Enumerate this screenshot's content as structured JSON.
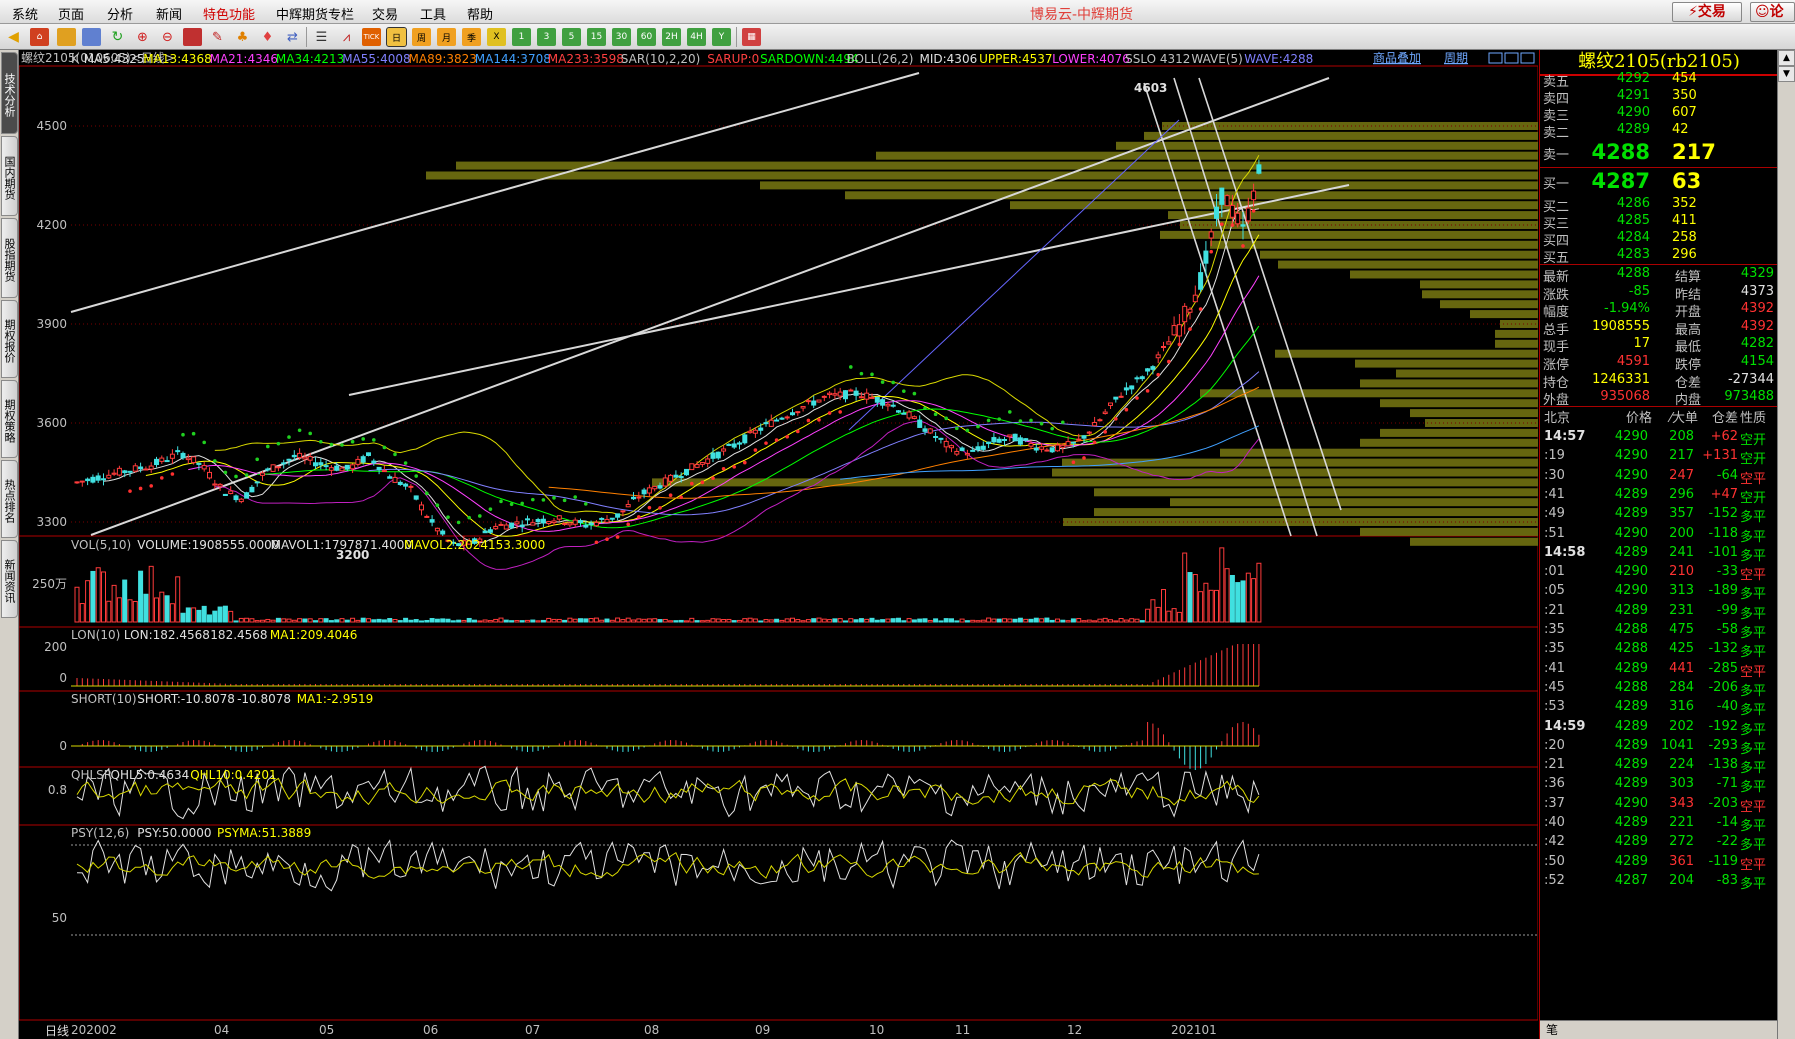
{
  "menu": {
    "items": [
      "系统",
      "页面",
      "分析",
      "新闻",
      "特色功能",
      "中辉期货专栏",
      "交易",
      "工具",
      "帮助"
    ],
    "highlight_index": 4,
    "app_title": "博易云-中辉期货",
    "trade_button": "交易",
    "comment_button": "论"
  },
  "left_tabs": [
    "技术分析",
    "国内期货",
    "股指期货",
    "期权报价",
    "期权策略",
    "热点排名",
    "新闻资讯"
  ],
  "chart": {
    "header_left": "螺纹2105(010605)<日线>",
    "header_link1": "商品叠加",
    "header_link2": "周期",
    "bottom_label": "日线",
    "main_indicators": [
      {
        "text": "K",
        "color": "#c0c0c0"
      },
      {
        "text": "MA5:4325",
        "color": "#e0e0e0"
      },
      {
        "text": "MA13:4368",
        "color": "#ffff00"
      },
      {
        "text": "MA21:4346",
        "color": "#ff40ff"
      },
      {
        "text": "MA34:4213",
        "color": "#00ff00"
      },
      {
        "text": "MA55:4008",
        "color": "#8080ff"
      },
      {
        "text": "MA89:3823",
        "color": "#ff8000"
      },
      {
        "text": "MA144:3708",
        "color": "#40a0ff"
      },
      {
        "text": "MA233:3598",
        "color": "#ff4040"
      },
      {
        "text": "SAR(10,2,20)",
        "color": "#c0c0c0"
      },
      {
        "text": "SARUP:0",
        "color": "#ff4040"
      },
      {
        "text": "SARDOWN:4494",
        "color": "#00ff00"
      },
      {
        "text": "BOLL(26,2)",
        "color": "#c0c0c0"
      },
      {
        "text": "MID:4306",
        "color": "#e0e0e0"
      },
      {
        "text": "UPPER:4537",
        "color": "#ffff00"
      },
      {
        "text": "LOWER:4076",
        "color": "#ff40ff"
      },
      {
        "text": "SSLO 4312",
        "color": "#c0c0c0"
      },
      {
        "text": "WAVE(5)",
        "color": "#c0c0c0"
      },
      {
        "text": "WAVE:4288",
        "color": "#8080ff"
      }
    ],
    "y_ticks": [
      "4500",
      "4200",
      "3900",
      "3600",
      "3300"
    ],
    "annotation_high": "4603",
    "annotation_low": "3200",
    "vol_panel": {
      "header": [
        {
          "text": "VOL(5,10)",
          "color": "#c0c0c0"
        },
        {
          "text": "VOLUME:1908555.0000",
          "color": "#e0e0e0"
        },
        {
          "text": "MAVOL1:1797871.4000",
          "color": "#e0e0e0"
        },
        {
          "text": "MAVOL2:2024153.3000",
          "color": "#ffff00"
        }
      ],
      "y_tick": "250万"
    },
    "lon_panel": {
      "header": [
        {
          "text": "LON(10)",
          "color": "#c0c0c0"
        },
        {
          "text": "LON:182.4568",
          "color": "#e0e0e0"
        },
        {
          "text": "182.4568",
          "color": "#e0e0e0"
        },
        {
          "text": "MA1:209.4046",
          "color": "#ffff00"
        }
      ],
      "y_ticks": [
        "200",
        "0"
      ]
    },
    "short_panel": {
      "header": [
        {
          "text": "SHORT(10)",
          "color": "#c0c0c0"
        },
        {
          "text": "SHORT:-10.8078",
          "color": "#e0e0e0"
        },
        {
          "text": "-10.8078",
          "color": "#e0e0e0"
        },
        {
          "text": "MA1:-2.9519",
          "color": "#ffff00"
        }
      ],
      "y_ticks": [
        "0"
      ]
    },
    "qhlsr_panel": {
      "header": [
        {
          "text": "QHLSR",
          "color": "#c0c0c0"
        },
        {
          "text": "QHL5:0.4634",
          "color": "#e0e0e0"
        },
        {
          "text": "QHL10:0.4201",
          "color": "#ffff00"
        }
      ],
      "y_ticks": [
        "0.8"
      ]
    },
    "psy_panel": {
      "header": [
        {
          "text": "PSY(12,6)",
          "color": "#c0c0c0"
        },
        {
          "text": "PSY:50.0000",
          "color": "#e0e0e0"
        },
        {
          "text": "PSYMA:51.3889",
          "color": "#ffff00"
        }
      ],
      "y_ticks": [
        "50"
      ]
    },
    "x_ticks": [
      "202002",
      "04",
      "05",
      "06",
      "07",
      "08",
      "09",
      "10",
      "11",
      "12",
      "202101"
    ]
  },
  "quote": {
    "title": "螺纹2105(rb2105)",
    "asks": [
      {
        "label": "卖五",
        "price": "4292",
        "vol": "454"
      },
      {
        "label": "卖四",
        "price": "4291",
        "vol": "350"
      },
      {
        "label": "卖三",
        "price": "4290",
        "vol": "607"
      },
      {
        "label": "卖二",
        "price": "4289",
        "vol": "42"
      },
      {
        "label": "卖一",
        "price": "4288",
        "vol": "217"
      }
    ],
    "bids": [
      {
        "label": "买一",
        "price": "4287",
        "vol": "63"
      },
      {
        "label": "买二",
        "price": "4286",
        "vol": "352"
      },
      {
        "label": "买三",
        "price": "4285",
        "vol": "411"
      },
      {
        "label": "买四",
        "price": "4284",
        "vol": "258"
      },
      {
        "label": "买五",
        "price": "4283",
        "vol": "296"
      }
    ],
    "fields": [
      {
        "l1": "最新",
        "v1": "4288",
        "c1": "dn",
        "l2": "结算",
        "v2": "4329",
        "c2": "dn"
      },
      {
        "l1": "涨跌",
        "v1": "-85",
        "c1": "dn",
        "l2": "昨结",
        "v2": "4373",
        "c2": "wh"
      },
      {
        "l1": "幅度",
        "v1": "-1.94%",
        "c1": "dn",
        "l2": "开盘",
        "v2": "4392",
        "c2": "up"
      },
      {
        "l1": "总手",
        "v1": "1908555",
        "c1": "yl",
        "l2": "最高",
        "v2": "4392",
        "c2": "up"
      },
      {
        "l1": "现手",
        "v1": "17",
        "c1": "yl",
        "l2": "最低",
        "v2": "4282",
        "c2": "dn"
      },
      {
        "l1": "涨停",
        "v1": "4591",
        "c1": "up",
        "l2": "跌停",
        "v2": "4154",
        "c2": "dn"
      },
      {
        "l1": "持仓",
        "v1": "1246331",
        "c1": "yl",
        "l2": "仓差",
        "v2": "-27344",
        "c2": "wh"
      },
      {
        "l1": "外盘",
        "v1": "935068",
        "c1": "up",
        "l2": "内盘",
        "v2": "973488",
        "c2": "dn"
      }
    ],
    "tick_header": {
      "time": "北京",
      "price": "价格",
      "vol": "⁄大单",
      "chg": "仓差",
      "nature": "性质"
    },
    "ticks": [
      {
        "t": "14:57",
        "b": true,
        "p": "4290",
        "v": "208",
        "vc": "dn",
        "c": "+62",
        "cc": "up",
        "n": "空开",
        "nc": "dn"
      },
      {
        "t": ":19",
        "b": false,
        "p": "4290",
        "v": "217",
        "vc": "dn",
        "c": "+131",
        "cc": "up",
        "n": "空开",
        "nc": "dn"
      },
      {
        "t": ":30",
        "b": false,
        "p": "4290",
        "v": "247",
        "vc": "up",
        "c": "-64",
        "cc": "dn",
        "n": "空平",
        "nc": "up"
      },
      {
        "t": ":41",
        "b": false,
        "p": "4289",
        "v": "296",
        "vc": "dn",
        "c": "+47",
        "cc": "up",
        "n": "空开",
        "nc": "dn"
      },
      {
        "t": ":49",
        "b": false,
        "p": "4289",
        "v": "357",
        "vc": "dn",
        "c": "-152",
        "cc": "dn",
        "n": "多平",
        "nc": "dn"
      },
      {
        "t": ":51",
        "b": false,
        "p": "4290",
        "v": "200",
        "vc": "dn",
        "c": "-118",
        "cc": "dn",
        "n": "多平",
        "nc": "dn"
      },
      {
        "t": "14:58",
        "b": true,
        "p": "4289",
        "v": "241",
        "vc": "dn",
        "c": "-101",
        "cc": "dn",
        "n": "多平",
        "nc": "dn"
      },
      {
        "t": ":01",
        "b": false,
        "p": "4290",
        "v": "210",
        "vc": "up",
        "c": "-33",
        "cc": "dn",
        "n": "空平",
        "nc": "up"
      },
      {
        "t": ":05",
        "b": false,
        "p": "4290",
        "v": "313",
        "vc": "dn",
        "c": "-189",
        "cc": "dn",
        "n": "多平",
        "nc": "dn"
      },
      {
        "t": ":21",
        "b": false,
        "p": "4289",
        "v": "231",
        "vc": "dn",
        "c": "-99",
        "cc": "dn",
        "n": "多平",
        "nc": "dn"
      },
      {
        "t": ":35",
        "b": false,
        "p": "4288",
        "v": "475",
        "vc": "dn",
        "c": "-58",
        "cc": "dn",
        "n": "多平",
        "nc": "dn"
      },
      {
        "t": ":35",
        "b": false,
        "p": "4288",
        "v": "425",
        "vc": "dn",
        "c": "-132",
        "cc": "dn",
        "n": "多平",
        "nc": "dn"
      },
      {
        "t": ":41",
        "b": false,
        "p": "4289",
        "v": "441",
        "vc": "up",
        "c": "-285",
        "cc": "dn",
        "n": "空平",
        "nc": "up"
      },
      {
        "t": ":45",
        "b": false,
        "p": "4288",
        "v": "284",
        "vc": "dn",
        "c": "-206",
        "cc": "dn",
        "n": "多平",
        "nc": "dn"
      },
      {
        "t": ":53",
        "b": false,
        "p": "4289",
        "v": "316",
        "vc": "dn",
        "c": "-40",
        "cc": "dn",
        "n": "多平",
        "nc": "dn"
      },
      {
        "t": "14:59",
        "b": true,
        "p": "4289",
        "v": "202",
        "vc": "dn",
        "c": "-192",
        "cc": "dn",
        "n": "多平",
        "nc": "dn"
      },
      {
        "t": ":20",
        "b": false,
        "p": "4289",
        "v": "1041",
        "vc": "dn",
        "c": "-293",
        "cc": "dn",
        "n": "多平",
        "nc": "dn"
      },
      {
        "t": ":21",
        "b": false,
        "p": "4289",
        "v": "224",
        "vc": "dn",
        "c": "-138",
        "cc": "dn",
        "n": "多平",
        "nc": "dn"
      },
      {
        "t": ":36",
        "b": false,
        "p": "4289",
        "v": "303",
        "vc": "dn",
        "c": "-71",
        "cc": "dn",
        "n": "多平",
        "nc": "dn"
      },
      {
        "t": ":37",
        "b": false,
        "p": "4290",
        "v": "343",
        "vc": "up",
        "c": "-203",
        "cc": "dn",
        "n": "空平",
        "nc": "up"
      },
      {
        "t": ":40",
        "b": false,
        "p": "4289",
        "v": "221",
        "vc": "dn",
        "c": "-14",
        "cc": "dn",
        "n": "多平",
        "nc": "dn"
      },
      {
        "t": ":42",
        "b": false,
        "p": "4289",
        "v": "272",
        "vc": "dn",
        "c": "-22",
        "cc": "dn",
        "n": "多平",
        "nc": "dn"
      },
      {
        "t": ":50",
        "b": false,
        "p": "4289",
        "v": "361",
        "vc": "up",
        "c": "-119",
        "cc": "dn",
        "n": "空平",
        "nc": "up"
      },
      {
        "t": ":52",
        "b": false,
        "p": "4287",
        "v": "204",
        "vc": "dn",
        "c": "-83",
        "cc": "dn",
        "n": "多平",
        "nc": "dn"
      }
    ],
    "bottom_tab": "笔"
  }
}
